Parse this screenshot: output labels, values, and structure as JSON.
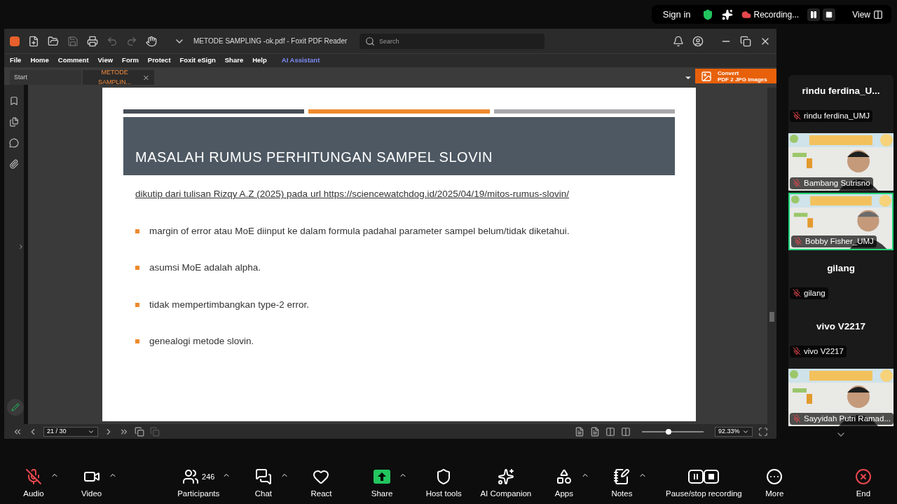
{
  "meeting_bar": {
    "sign_in": "Sign in",
    "recording": "Recording...",
    "view": "View"
  },
  "pdf_window": {
    "title": "METODE SAMPLING -ok.pdf - Foxit PDF Reader",
    "search": {
      "placeholder": "Search"
    },
    "menu": [
      {
        "label": "File",
        "kind": "plain"
      },
      {
        "label": "Home",
        "kind": "plain"
      },
      {
        "label": "Comment",
        "kind": "plain"
      },
      {
        "label": "View",
        "kind": "plain"
      },
      {
        "label": "Form",
        "kind": "plain"
      },
      {
        "label": "Protect",
        "kind": "plain"
      },
      {
        "label": "Foxit eSign",
        "kind": "plain"
      },
      {
        "label": "Share",
        "kind": "plain"
      },
      {
        "label": "Help",
        "kind": "plain"
      },
      {
        "label": "AI Assistant",
        "kind": "ai"
      }
    ],
    "tabs": [
      {
        "label": "Start",
        "selected": false
      },
      {
        "label": "METODE SAMPLIN...",
        "selected": true
      }
    ],
    "convert_banner": {
      "line_1": "Convert",
      "line_2": "PDF 2 JPG images"
    },
    "slide": {
      "title": "MASALAH RUMUS PERHITUNGAN SAMPEL SLOVIN",
      "source": "dikutip dari tulisan Rizqy A.Z (2025) pada url https://sciencewatchdog.id/2025/04/19/mitos-rumus-slovin/",
      "bullets": [
        "margin of error atau MoE diinput ke dalam formula padahal parameter sampel belum/tidak diketahui.",
        "asumsi MoE adalah alpha.",
        "tidak mempertimbangkan type-2 error.",
        "genealogi metode slovin."
      ]
    },
    "status_bar": {
      "page": "21 / 30",
      "zoom": "92.33%",
      "zoom_slider": {
        "level": 0.43
      }
    }
  },
  "participants": [
    {
      "kind": "name",
      "heading": "rindu  ferdina_U...",
      "name": "rindu ferdina_UMJ",
      "speaking": false
    },
    {
      "kind": "video",
      "name": "Bambang Sutrisno",
      "speaking": false
    },
    {
      "kind": "video",
      "name": "Bobby Fisher_UMJ",
      "speaking": true
    },
    {
      "kind": "name",
      "heading": "gilang",
      "name": "gilang",
      "speaking": false
    },
    {
      "kind": "name",
      "heading": "vivo V2217",
      "name": "vivo V2217",
      "speaking": false
    },
    {
      "kind": "video",
      "name": "Sayyidah Putri Ramad...",
      "speaking": false
    }
  ],
  "toolbar": [
    {
      "label": "Audio",
      "kind": "audio",
      "muted": true,
      "caret": true
    },
    {
      "label": "Video",
      "kind": "video",
      "caret": true
    },
    {
      "label": "Participants",
      "kind": "participants",
      "count": "246",
      "caret": true
    },
    {
      "label": "Chat",
      "kind": "chat",
      "caret": true
    },
    {
      "label": "React",
      "kind": "react",
      "caret": false
    },
    {
      "label": "Share",
      "kind": "share",
      "caret": true
    },
    {
      "label": "Host tools",
      "kind": "host",
      "caret": false
    },
    {
      "label": "AI Companion",
      "kind": "ai",
      "caret": false
    },
    {
      "label": "Apps",
      "kind": "apps",
      "caret": true
    },
    {
      "label": "Notes",
      "kind": "notes",
      "caret": true
    },
    {
      "label": "Pause/stop recording",
      "kind": "record",
      "caret": false
    },
    {
      "label": "More",
      "kind": "more",
      "caret": false
    },
    {
      "label": "End",
      "kind": "end",
      "caret": false
    }
  ]
}
